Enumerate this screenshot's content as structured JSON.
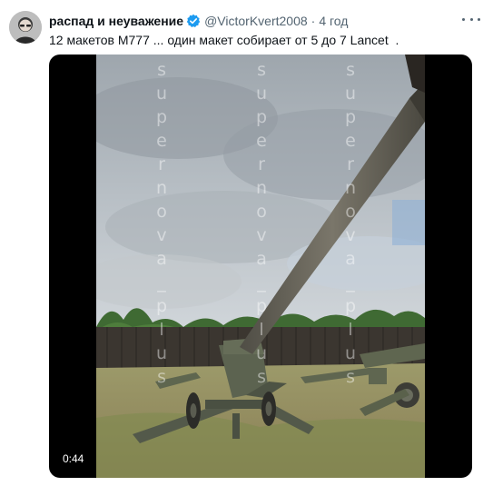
{
  "tweet": {
    "author": {
      "display_name": "распад и неуважение",
      "handle": "@VictorKvert2008",
      "verified_icon": "verified-badge-icon"
    },
    "separator": "·",
    "timestamp": "4 год",
    "more_icon": "more-options-icon",
    "text": "12 макетов M777 ... один макет собирает от 5 до 7 Lancet  .",
    "media": {
      "type": "video",
      "duration": "0:44",
      "watermark": "supernova_plus"
    }
  },
  "colors": {
    "verified": "#1d9bf0",
    "secondary_text": "#536471",
    "primary_text": "#0f1419"
  }
}
